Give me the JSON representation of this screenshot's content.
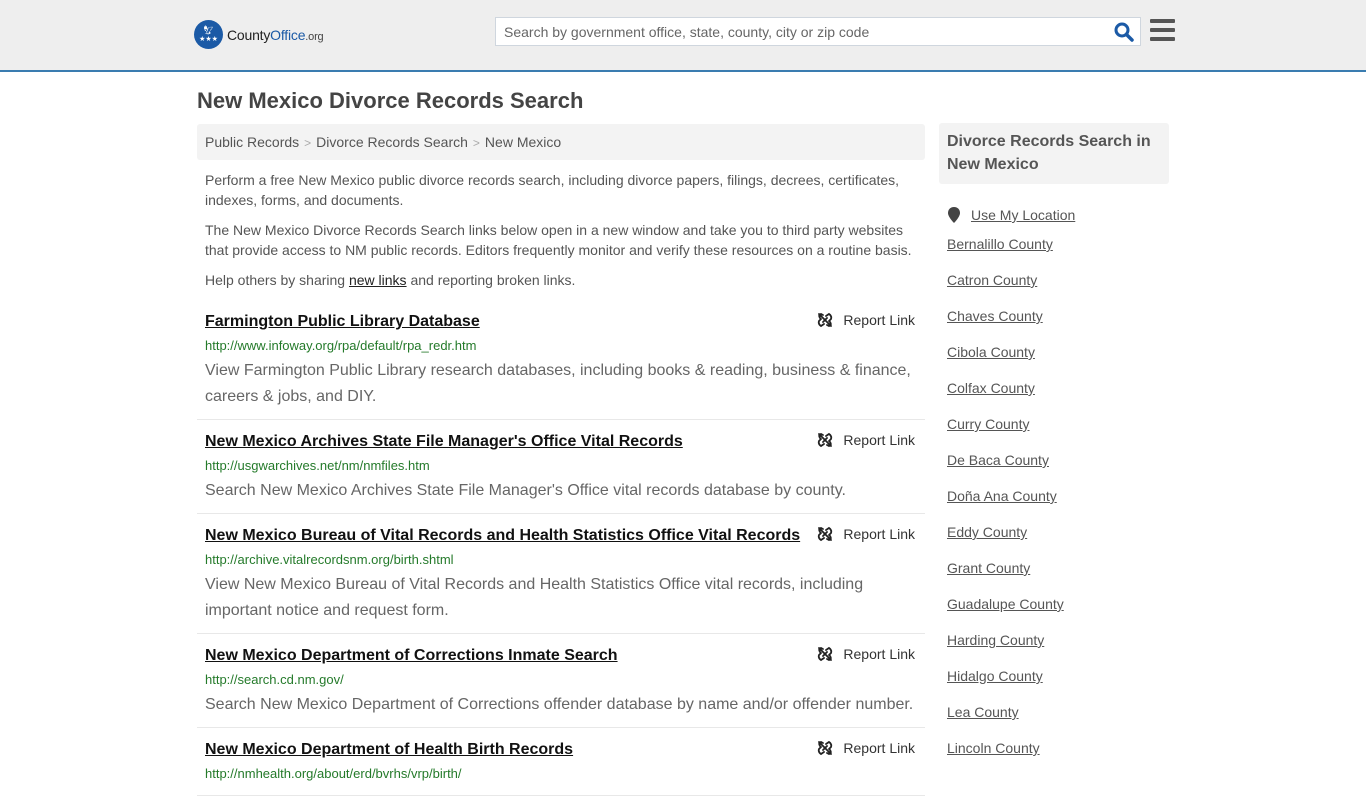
{
  "header": {
    "logo": {
      "name_part1": "County",
      "name_part2": "Office",
      "name_part3": ".org",
      "brand_color": "#1b5aa6"
    },
    "search": {
      "placeholder": "Search by government office, state, county, city or zip code",
      "value": ""
    },
    "accent_color": "#3a7cb0"
  },
  "page": {
    "title": "New Mexico Divorce Records Search"
  },
  "breadcrumb": [
    {
      "label": "Public Records"
    },
    {
      "label": "Divorce Records Search"
    },
    {
      "label": "New Mexico"
    }
  ],
  "intro": {
    "p1": "Perform a free New Mexico public divorce records search, including divorce papers, filings, decrees, certificates, indexes, forms, and documents.",
    "p2": "The New Mexico Divorce Records Search links below open in a new window and take you to third party websites that provide access to NM public records. Editors frequently monitor and verify these resources on a routine basis.",
    "p3_before": "Help others by sharing ",
    "p3_link": "new links",
    "p3_after": " and reporting broken links."
  },
  "report_label": "Report Link",
  "results": [
    {
      "title": "Farmington Public Library Database",
      "url": "http://www.infoway.org/rpa/default/rpa_redr.htm",
      "description": "View Farmington Public Library research databases, including books & reading, business & finance, careers & jobs, and DIY."
    },
    {
      "title": "New Mexico Archives State File Manager's Office Vital Records",
      "url": "http://usgwarchives.net/nm/nmfiles.htm",
      "description": "Search New Mexico Archives State File Manager's Office vital records database by county."
    },
    {
      "title": "New Mexico Bureau of Vital Records and Health Statistics Office Vital Records",
      "url": "http://archive.vitalrecordsnm.org/birth.shtml",
      "description": "View New Mexico Bureau of Vital Records and Health Statistics Office vital records, including important notice and request form."
    },
    {
      "title": "New Mexico Department of Corrections Inmate Search",
      "url": "http://search.cd.nm.gov/",
      "description": "Search New Mexico Department of Corrections offender database by name and/or offender number."
    },
    {
      "title": "New Mexico Department of Health Birth Records",
      "url": "http://nmhealth.org/about/erd/bvrhs/vrp/birth/",
      "description": ""
    }
  ],
  "sidebar": {
    "heading": "Divorce Records Search in New Mexico",
    "use_location": "Use My Location",
    "counties": [
      "Bernalillo County",
      "Catron County",
      "Chaves County",
      "Cibola County",
      "Colfax County",
      "Curry County",
      "De Baca County",
      "Doña Ana County",
      "Eddy County",
      "Grant County",
      "Guadalupe County",
      "Harding County",
      "Hidalgo County",
      "Lea County",
      "Lincoln County"
    ]
  }
}
